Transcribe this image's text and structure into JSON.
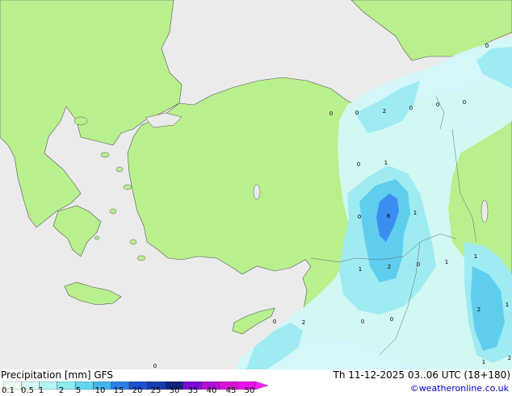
{
  "legend": {
    "title": "Precipitation [mm]  GFS",
    "levels": [
      "0.1",
      "0.5",
      "1",
      "2",
      "5",
      "10",
      "15",
      "20",
      "25",
      "30",
      "35",
      "40",
      "45",
      "50"
    ],
    "colors": [
      "#f0fff0",
      "#d9fdf7",
      "#b4f5f5",
      "#8ceaf2",
      "#66d7f0",
      "#46b4ee",
      "#2b7fe6",
      "#1f4fd3",
      "#183bb0",
      "#10237f",
      "#7c0dd8",
      "#b00ed6",
      "#d412d6",
      "#ee10ee",
      "#ff20ff"
    ]
  },
  "run_info": "Th 11-12-2025 03..06 UTC (18+180)",
  "credit": "©weatheronline.co.uk",
  "colors": {
    "land": "#b8f08e",
    "sea": "#ebebeb",
    "precip_light": "#d3f8fa",
    "precip_medium": "#9eebf2",
    "precip_heavy": "#5fcdee",
    "precip_core": "#3b8ef0"
  },
  "contour_labels": [
    "0",
    "0",
    "2",
    "0",
    "0",
    "0",
    "0",
    "1",
    "0",
    "8",
    "1",
    "2",
    "1",
    "1",
    "0",
    "1",
    "2",
    "0",
    "0",
    "0",
    "2",
    "0",
    "1",
    "2",
    "1",
    "0"
  ]
}
